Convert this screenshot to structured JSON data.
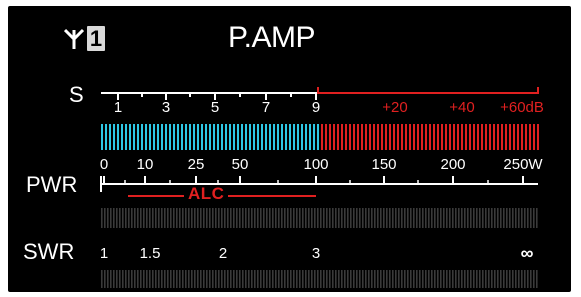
{
  "header": {
    "antenna_number": "1",
    "mode_title": "P.AMP",
    "antenna_icon": "antenna-icon"
  },
  "s_meter": {
    "name": "S",
    "white_ticks": [
      "1",
      "3",
      "5",
      "7",
      "9"
    ],
    "red_ticks": [
      "+20",
      "+40",
      "+60dB"
    ],
    "level_units_s": "9+",
    "cyan_color": "#2ec8e6",
    "red_color": "#e02020"
  },
  "pwr_meter": {
    "name": "PWR",
    "ticks": [
      "0",
      "10",
      "25",
      "50",
      "100",
      "150",
      "200",
      "250W"
    ]
  },
  "alc_meter": {
    "label": "ALC"
  },
  "swr_meter": {
    "name": "SWR",
    "ticks": [
      "1",
      "1.5",
      "2",
      "3",
      "∞"
    ]
  },
  "colors": {
    "background": "#000000",
    "scale": "#ffffff",
    "segment_off": "#3a3a3a",
    "accent_red": "#e02020",
    "accent_cyan": "#2ec8e6"
  }
}
